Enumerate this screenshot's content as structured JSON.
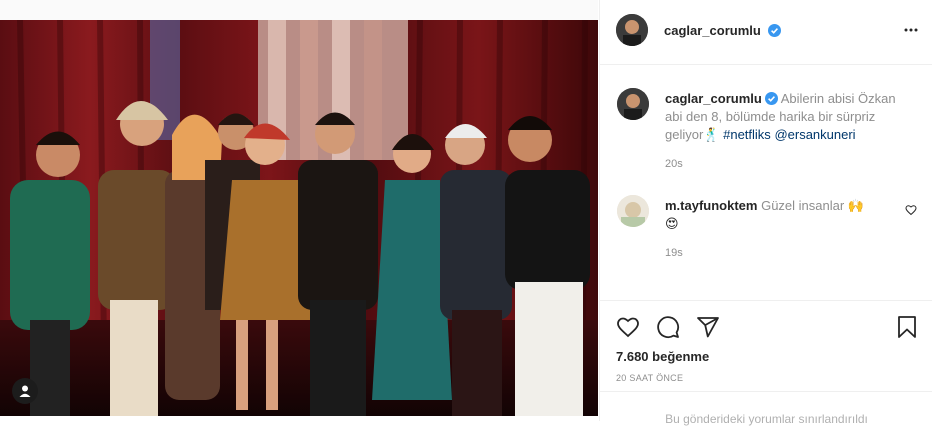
{
  "post": {
    "author": "caglar_corumlu",
    "photo_alt": "Ersan Kuneri cast photo"
  },
  "caption": {
    "username": "caglar_corumlu",
    "text": "Abilerin abisi Özkan abi den 8, bölümde harika bir sürpriz geliyor",
    "emoji": "🕺",
    "hashtag": "#netfliks",
    "mention": "@ersankuneri",
    "time": "20s"
  },
  "comments": [
    {
      "username": "m.tayfunoktem",
      "text": "Güzel insanlar",
      "emoji1": "🙌",
      "emoji2": "😍",
      "time": "19s"
    }
  ],
  "stats": {
    "likes": "7.680 beğenme",
    "posted": "20 SAAT ÖNCE"
  },
  "footer": {
    "comments_limited": "Bu gönderideki yorumlar sınırlandırıldı"
  },
  "icons": {
    "verified": "verified-badge-icon",
    "more": "more-options-icon",
    "like": "heart-icon",
    "comment": "comment-bubble-icon",
    "share": "paper-plane-icon",
    "save": "bookmark-icon",
    "tagged": "tagged-user-icon"
  },
  "colors": {
    "verified_blue": "#3897f0",
    "link_blue": "#00376b",
    "secondary_gray": "#8e8e8e"
  }
}
